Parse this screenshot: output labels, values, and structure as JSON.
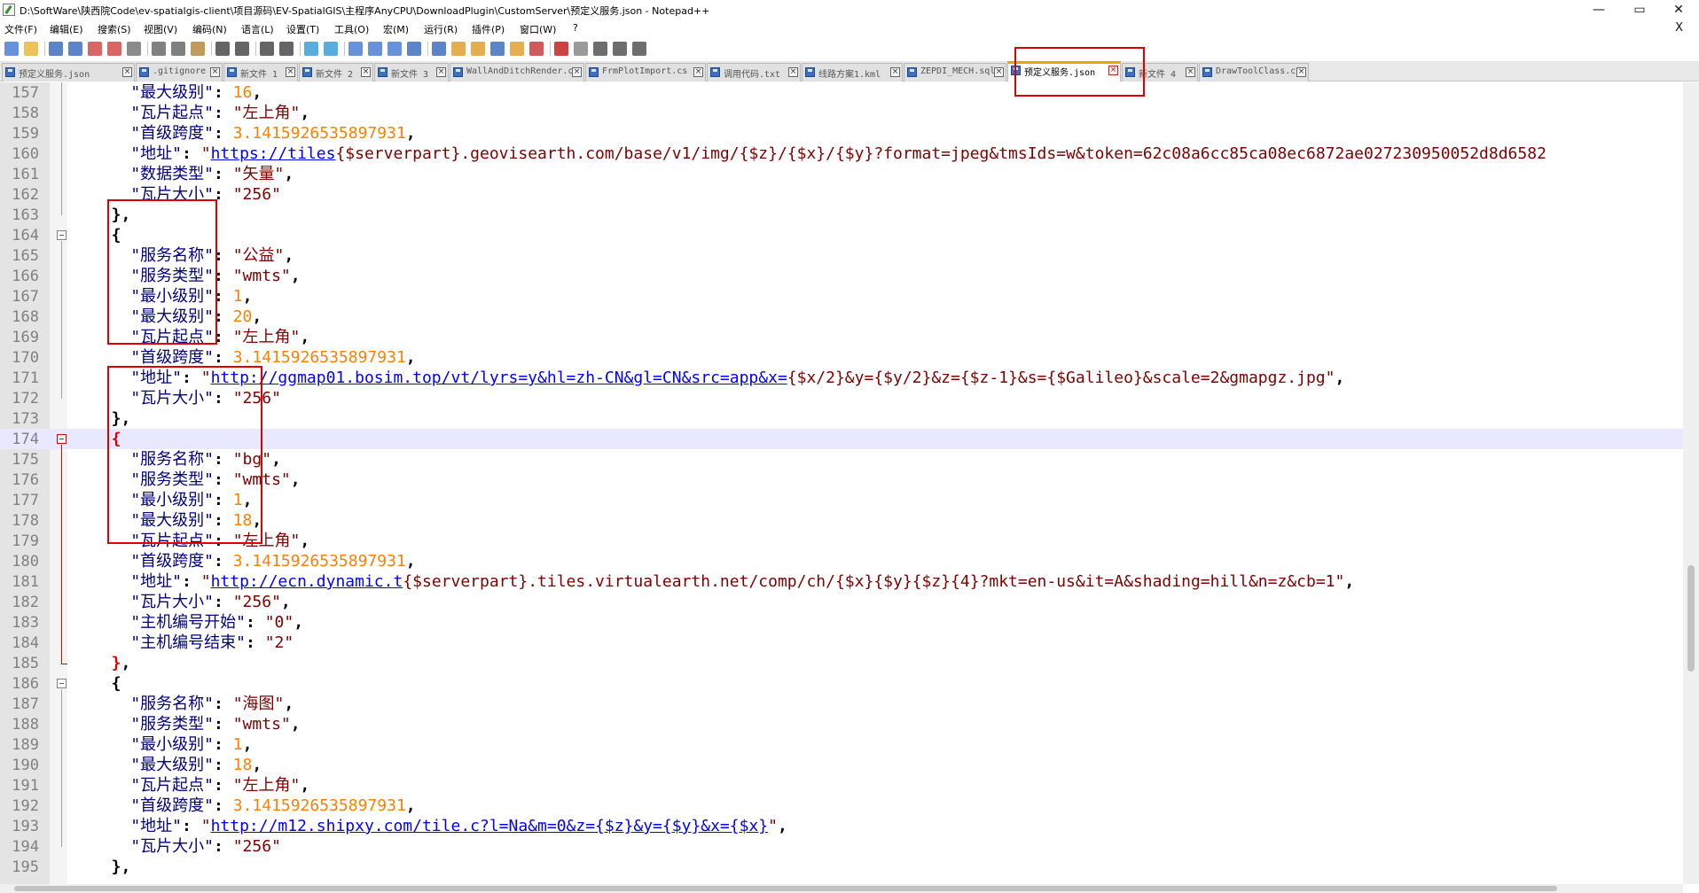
{
  "window": {
    "title": "D:\\SoftWare\\陕西院Code\\ev-spatialgis-client\\项目源码\\EV-SpatialGIS\\主程序AnyCPU\\DownloadPlugin\\CustomServer\\预定义服务.json - Notepad++",
    "minimize": "—",
    "maximize": "▭",
    "close": "✕"
  },
  "menu": {
    "items": [
      "文件(F)",
      "编辑(E)",
      "搜索(S)",
      "视图(V)",
      "编码(N)",
      "语言(L)",
      "设置(T)",
      "工具(O)",
      "宏(M)",
      "运行(R)",
      "插件(P)",
      "窗口(W)",
      "?"
    ],
    "close": "X"
  },
  "toolbar": {
    "icons": [
      "new-file-icon",
      "open-file-icon",
      "save-icon",
      "save-all-icon",
      "close-icon",
      "close-all-icon",
      "print-icon",
      "cut-icon",
      "copy-icon",
      "paste-icon",
      "undo-icon",
      "redo-icon",
      "find-icon",
      "replace-icon",
      "zoom-in-icon",
      "zoom-out-icon",
      "sync-v-icon",
      "sync-h-icon",
      "word-wrap-icon",
      "show-all-chars-icon",
      "indent-guide-icon",
      "udl-icon",
      "doc-map-icon",
      "function-list-icon",
      "folder-workspace-icon",
      "monitoring-icon",
      "record-macro-icon",
      "stop-macro-icon",
      "play-macro-icon",
      "run-macro-multiple-icon",
      "save-macro-icon"
    ]
  },
  "tabs": [
    {
      "label": "预定义服务.json"
    },
    {
      "label": ".gitignore"
    },
    {
      "label": "新文件 1"
    },
    {
      "label": "新文件 2"
    },
    {
      "label": "新文件 3"
    },
    {
      "label": "WallAndDitchRender.cs"
    },
    {
      "label": "FrmPlotImport.cs"
    },
    {
      "label": "调用代码.txt"
    },
    {
      "label": "线路方案1.kml"
    },
    {
      "label": "ZEPDI_MECH.sql"
    },
    {
      "label": "预定义服务.json",
      "active": true
    },
    {
      "label": "新文件 4"
    },
    {
      "label": "DrawToolClass.cs"
    }
  ],
  "colors": {
    "accent_tab": "#f0a300",
    "annotation": "#e00000",
    "key": "#000080",
    "string": "#800000",
    "number": "#ff8000",
    "url": "#0000ff"
  },
  "lines": [
    {
      "n": "157",
      "parts": [
        [
          "k",
          "    \"最大级别\""
        ],
        [
          "p",
          ": "
        ],
        [
          "n",
          "16"
        ],
        [
          "p",
          ","
        ]
      ]
    },
    {
      "n": "158",
      "parts": [
        [
          "k",
          "    \"瓦片起点\""
        ],
        [
          "p",
          ": "
        ],
        [
          "s",
          "\"左上角\""
        ],
        [
          "p",
          ","
        ]
      ]
    },
    {
      "n": "159",
      "parts": [
        [
          "k",
          "    \"首级跨度\""
        ],
        [
          "p",
          ": "
        ],
        [
          "n",
          "3.1415926535897931"
        ],
        [
          "p",
          ","
        ]
      ]
    },
    {
      "n": "160",
      "parts": [
        [
          "k",
          "    \"地址\""
        ],
        [
          "p",
          ": "
        ],
        [
          "s",
          "\""
        ],
        [
          "u",
          "https://tiles"
        ],
        [
          "s",
          "{$serverpart}.geovisearth.com/base/v1/img/{$z}/{$x}/{$y}?format=jpeg&tmsIds=w&token=62c08a6cc85ca08ec6872ae027230950052d8d6582"
        ]
      ]
    },
    {
      "n": "161",
      "parts": [
        [
          "k",
          "    \"数据类型\""
        ],
        [
          "p",
          ": "
        ],
        [
          "s",
          "\"矢量\""
        ],
        [
          "p",
          ","
        ]
      ]
    },
    {
      "n": "162",
      "parts": [
        [
          "k",
          "    \"瓦片大小\""
        ],
        [
          "p",
          ": "
        ],
        [
          "s",
          "\"256\""
        ]
      ]
    },
    {
      "n": "163",
      "parts": [
        [
          "p",
          "  },"
        ]
      ]
    },
    {
      "n": "164",
      "parts": [
        [
          "p",
          "  {"
        ]
      ],
      "fold": "box"
    },
    {
      "n": "165",
      "parts": [
        [
          "k",
          "    \"服务名称\""
        ],
        [
          "p",
          ": "
        ],
        [
          "s",
          "\"公益\""
        ],
        [
          "p",
          ","
        ]
      ]
    },
    {
      "n": "166",
      "parts": [
        [
          "k",
          "    \"服务类型\""
        ],
        [
          "p",
          ": "
        ],
        [
          "s",
          "\"wmts\""
        ],
        [
          "p",
          ","
        ]
      ]
    },
    {
      "n": "167",
      "parts": [
        [
          "k",
          "    \"最小级别\""
        ],
        [
          "p",
          ": "
        ],
        [
          "n",
          "1"
        ],
        [
          "p",
          ","
        ]
      ]
    },
    {
      "n": "168",
      "parts": [
        [
          "k",
          "    \"最大级别\""
        ],
        [
          "p",
          ": "
        ],
        [
          "n",
          "20"
        ],
        [
          "p",
          ","
        ]
      ]
    },
    {
      "n": "169",
      "parts": [
        [
          "k",
          "    \"瓦片起点\""
        ],
        [
          "p",
          ": "
        ],
        [
          "s",
          "\"左上角\""
        ],
        [
          "p",
          ","
        ]
      ]
    },
    {
      "n": "170",
      "parts": [
        [
          "k",
          "    \"首级跨度\""
        ],
        [
          "p",
          ": "
        ],
        [
          "n",
          "3.1415926535897931"
        ],
        [
          "p",
          ","
        ]
      ]
    },
    {
      "n": "171",
      "parts": [
        [
          "k",
          "    \"地址\""
        ],
        [
          "p",
          ": "
        ],
        [
          "s",
          "\""
        ],
        [
          "u",
          "http://ggmap01.bosim.top/vt/lyrs=y&hl=zh-CN&gl=CN&src=app&x="
        ],
        [
          "s",
          "{$x/2}&y={$y/2}&z={$z-1}&s={$Galileo}&scale=2&gmapgz.jpg\""
        ],
        [
          "p",
          ","
        ]
      ]
    },
    {
      "n": "172",
      "parts": [
        [
          "k",
          "    \"瓦片大小\""
        ],
        [
          "p",
          ": "
        ],
        [
          "s",
          "\"256\""
        ]
      ]
    },
    {
      "n": "173",
      "parts": [
        [
          "p",
          "  },"
        ]
      ]
    },
    {
      "n": "174",
      "parts": [
        [
          "br-red",
          "  {"
        ]
      ],
      "fold": "red",
      "current": true
    },
    {
      "n": "175",
      "parts": [
        [
          "k",
          "    \"服务名称\""
        ],
        [
          "p",
          ": "
        ],
        [
          "s",
          "\"bg\""
        ],
        [
          "p",
          ","
        ]
      ]
    },
    {
      "n": "176",
      "parts": [
        [
          "k",
          "    \"服务类型\""
        ],
        [
          "p",
          ": "
        ],
        [
          "s",
          "\"wmts\""
        ],
        [
          "p",
          ","
        ]
      ]
    },
    {
      "n": "177",
      "parts": [
        [
          "k",
          "    \"最小级别\""
        ],
        [
          "p",
          ": "
        ],
        [
          "n",
          "1"
        ],
        [
          "p",
          ","
        ]
      ]
    },
    {
      "n": "178",
      "parts": [
        [
          "k",
          "    \"最大级别\""
        ],
        [
          "p",
          ": "
        ],
        [
          "n",
          "18"
        ],
        [
          "p",
          ","
        ]
      ]
    },
    {
      "n": "179",
      "parts": [
        [
          "k",
          "    \"瓦片起点\""
        ],
        [
          "p",
          ": "
        ],
        [
          "s",
          "\"左上角\""
        ],
        [
          "p",
          ","
        ]
      ]
    },
    {
      "n": "180",
      "parts": [
        [
          "k",
          "    \"首级跨度\""
        ],
        [
          "p",
          ": "
        ],
        [
          "n",
          "3.1415926535897931"
        ],
        [
          "p",
          ","
        ]
      ]
    },
    {
      "n": "181",
      "parts": [
        [
          "k",
          "    \"地址\""
        ],
        [
          "p",
          ": "
        ],
        [
          "s",
          "\""
        ],
        [
          "u",
          "http://ecn.dynamic.t"
        ],
        [
          "s",
          "{$serverpart}.tiles.virtualearth.net/comp/ch/{$x}{$y}{$z}{4}?mkt=en-us&it=A&shading=hill&n=z&cb=1\""
        ],
        [
          "p",
          ","
        ]
      ]
    },
    {
      "n": "182",
      "parts": [
        [
          "k",
          "    \"瓦片大小\""
        ],
        [
          "p",
          ": "
        ],
        [
          "s",
          "\"256\""
        ],
        [
          "p",
          ","
        ]
      ]
    },
    {
      "n": "183",
      "parts": [
        [
          "k",
          "    \"主机编号开始\""
        ],
        [
          "p",
          ": "
        ],
        [
          "s",
          "\"0\""
        ],
        [
          "p",
          ","
        ]
      ]
    },
    {
      "n": "184",
      "parts": [
        [
          "k",
          "    \"主机编号结束\""
        ],
        [
          "p",
          ": "
        ],
        [
          "s",
          "\"2\""
        ]
      ]
    },
    {
      "n": "185",
      "parts": [
        [
          "br-red",
          "  }"
        ],
        [
          "p",
          ","
        ]
      ],
      "fold": "red-end"
    },
    {
      "n": "186",
      "parts": [
        [
          "p",
          "  {"
        ]
      ],
      "fold": "box"
    },
    {
      "n": "187",
      "parts": [
        [
          "k",
          "    \"服务名称\""
        ],
        [
          "p",
          ": "
        ],
        [
          "s",
          "\"海图\""
        ],
        [
          "p",
          ","
        ]
      ]
    },
    {
      "n": "188",
      "parts": [
        [
          "k",
          "    \"服务类型\""
        ],
        [
          "p",
          ": "
        ],
        [
          "s",
          "\"wmts\""
        ],
        [
          "p",
          ","
        ]
      ]
    },
    {
      "n": "189",
      "parts": [
        [
          "k",
          "    \"最小级别\""
        ],
        [
          "p",
          ": "
        ],
        [
          "n",
          "1"
        ],
        [
          "p",
          ","
        ]
      ]
    },
    {
      "n": "190",
      "parts": [
        [
          "k",
          "    \"最大级别\""
        ],
        [
          "p",
          ": "
        ],
        [
          "n",
          "18"
        ],
        [
          "p",
          ","
        ]
      ]
    },
    {
      "n": "191",
      "parts": [
        [
          "k",
          "    \"瓦片起点\""
        ],
        [
          "p",
          ": "
        ],
        [
          "s",
          "\"左上角\""
        ],
        [
          "p",
          ","
        ]
      ]
    },
    {
      "n": "192",
      "parts": [
        [
          "k",
          "    \"首级跨度\""
        ],
        [
          "p",
          ": "
        ],
        [
          "n",
          "3.1415926535897931"
        ],
        [
          "p",
          ","
        ]
      ]
    },
    {
      "n": "193",
      "parts": [
        [
          "k",
          "    \"地址\""
        ],
        [
          "p",
          ": "
        ],
        [
          "s",
          "\""
        ],
        [
          "u",
          "http://m12.shipxy.com/tile.c?l=Na&m=0&z={$z}&y={$y}&x={$x}"
        ],
        [
          "s",
          "\""
        ],
        [
          "p",
          ","
        ]
      ]
    },
    {
      "n": "194",
      "parts": [
        [
          "k",
          "    \"瓦片大小\""
        ],
        [
          "p",
          ": "
        ],
        [
          "s",
          "\"256\""
        ]
      ]
    },
    {
      "n": "195",
      "parts": [
        [
          "p",
          "  },"
        ]
      ]
    }
  ]
}
